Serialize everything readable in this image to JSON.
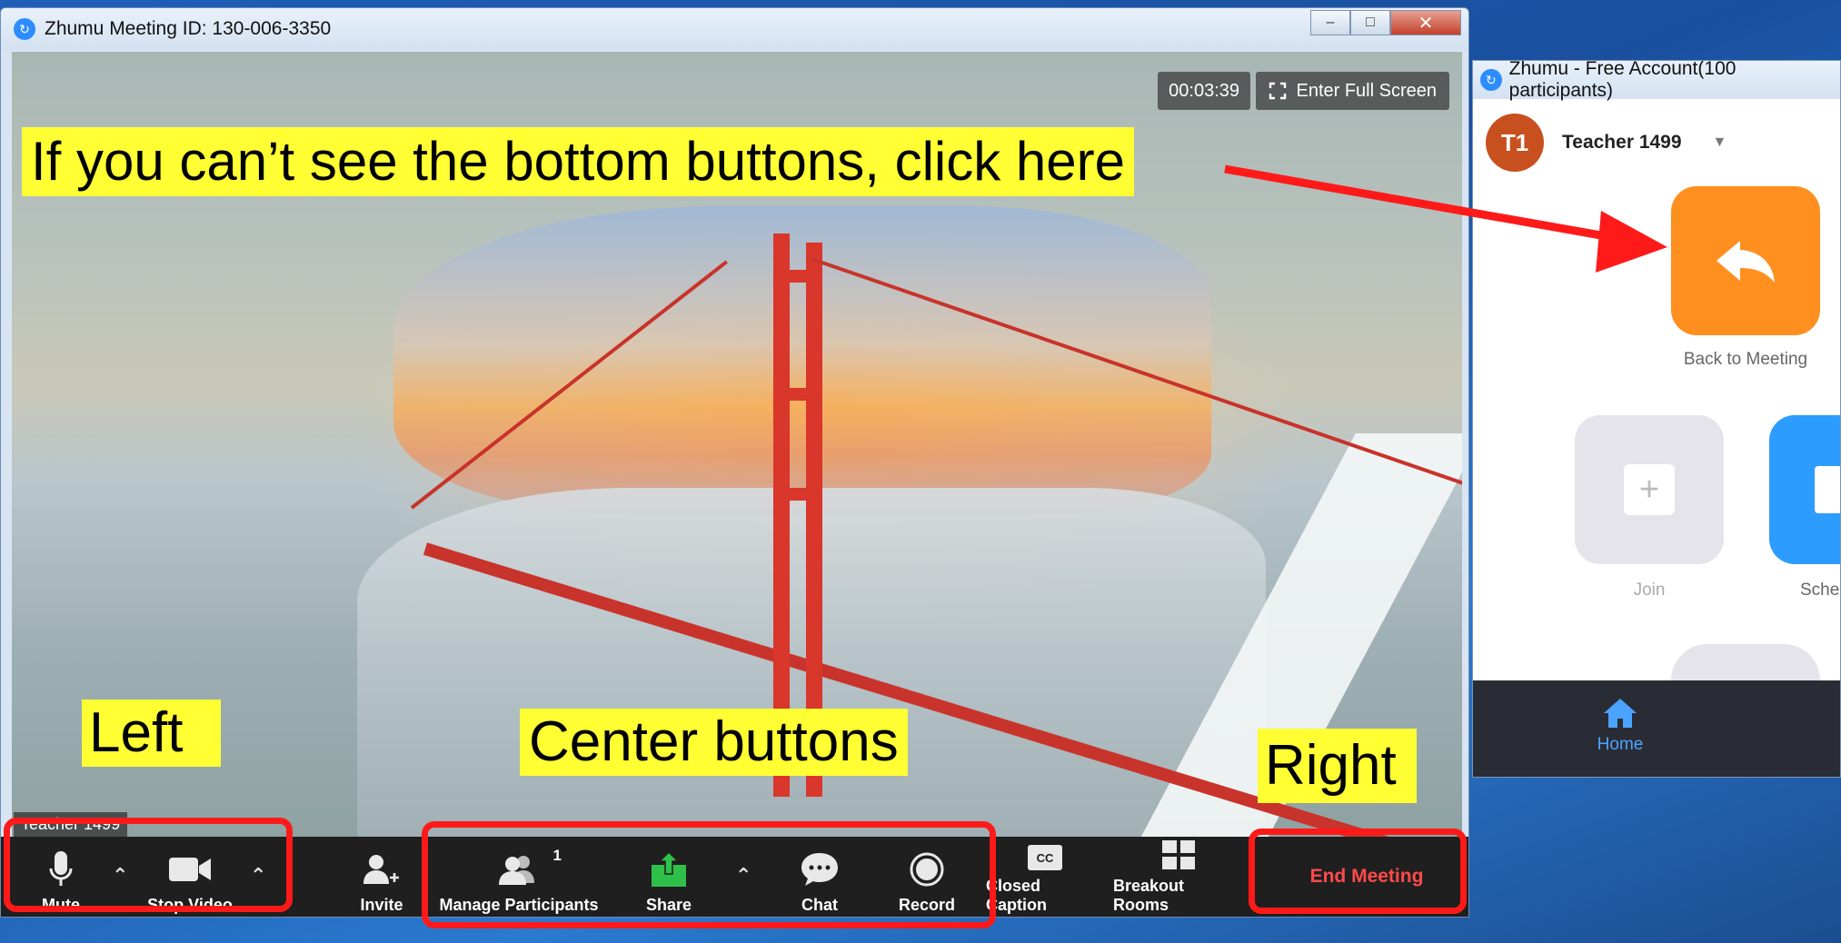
{
  "meeting_window": {
    "title": "Zhumu Meeting ID: 130-006-3350",
    "controls": {
      "minimize": "–",
      "restore": "□",
      "close": "✕"
    },
    "timer": "00:03:39",
    "fullscreen_label": "Enter Full Screen",
    "participant_name": "Teacher 1499"
  },
  "toolbar": {
    "mute": "Mute",
    "stop_video": "Stop Video",
    "invite": "Invite",
    "manage_participants": "Manage Participants",
    "participant_count": "1",
    "share": "Share",
    "chat": "Chat",
    "record": "Record",
    "closed_caption": "Closed Caption",
    "cc_glyph": "CC",
    "breakout_rooms": "Breakout Rooms",
    "end_meeting": "End Meeting"
  },
  "annotations": {
    "top_callout": "If you can’t see the bottom buttons, click here",
    "left": "Left",
    "center": "Center buttons",
    "right": "Right"
  },
  "side_window": {
    "title": "Zhumu - Free Account(100 participants)",
    "avatar_initials": "T1",
    "user_name": "Teacher 1499",
    "back_to_meeting": "Back to Meeting",
    "join": "Join",
    "schedule_partial": "Sche",
    "home": "Home"
  },
  "colors": {
    "annotation_red": "#ff1a1a",
    "callout_yellow": "#ffff33",
    "back_tile_orange": "#ff8f1f",
    "share_green": "#2fc04a",
    "end_red": "#ff4a4a",
    "accent_blue": "#2d8cff"
  }
}
